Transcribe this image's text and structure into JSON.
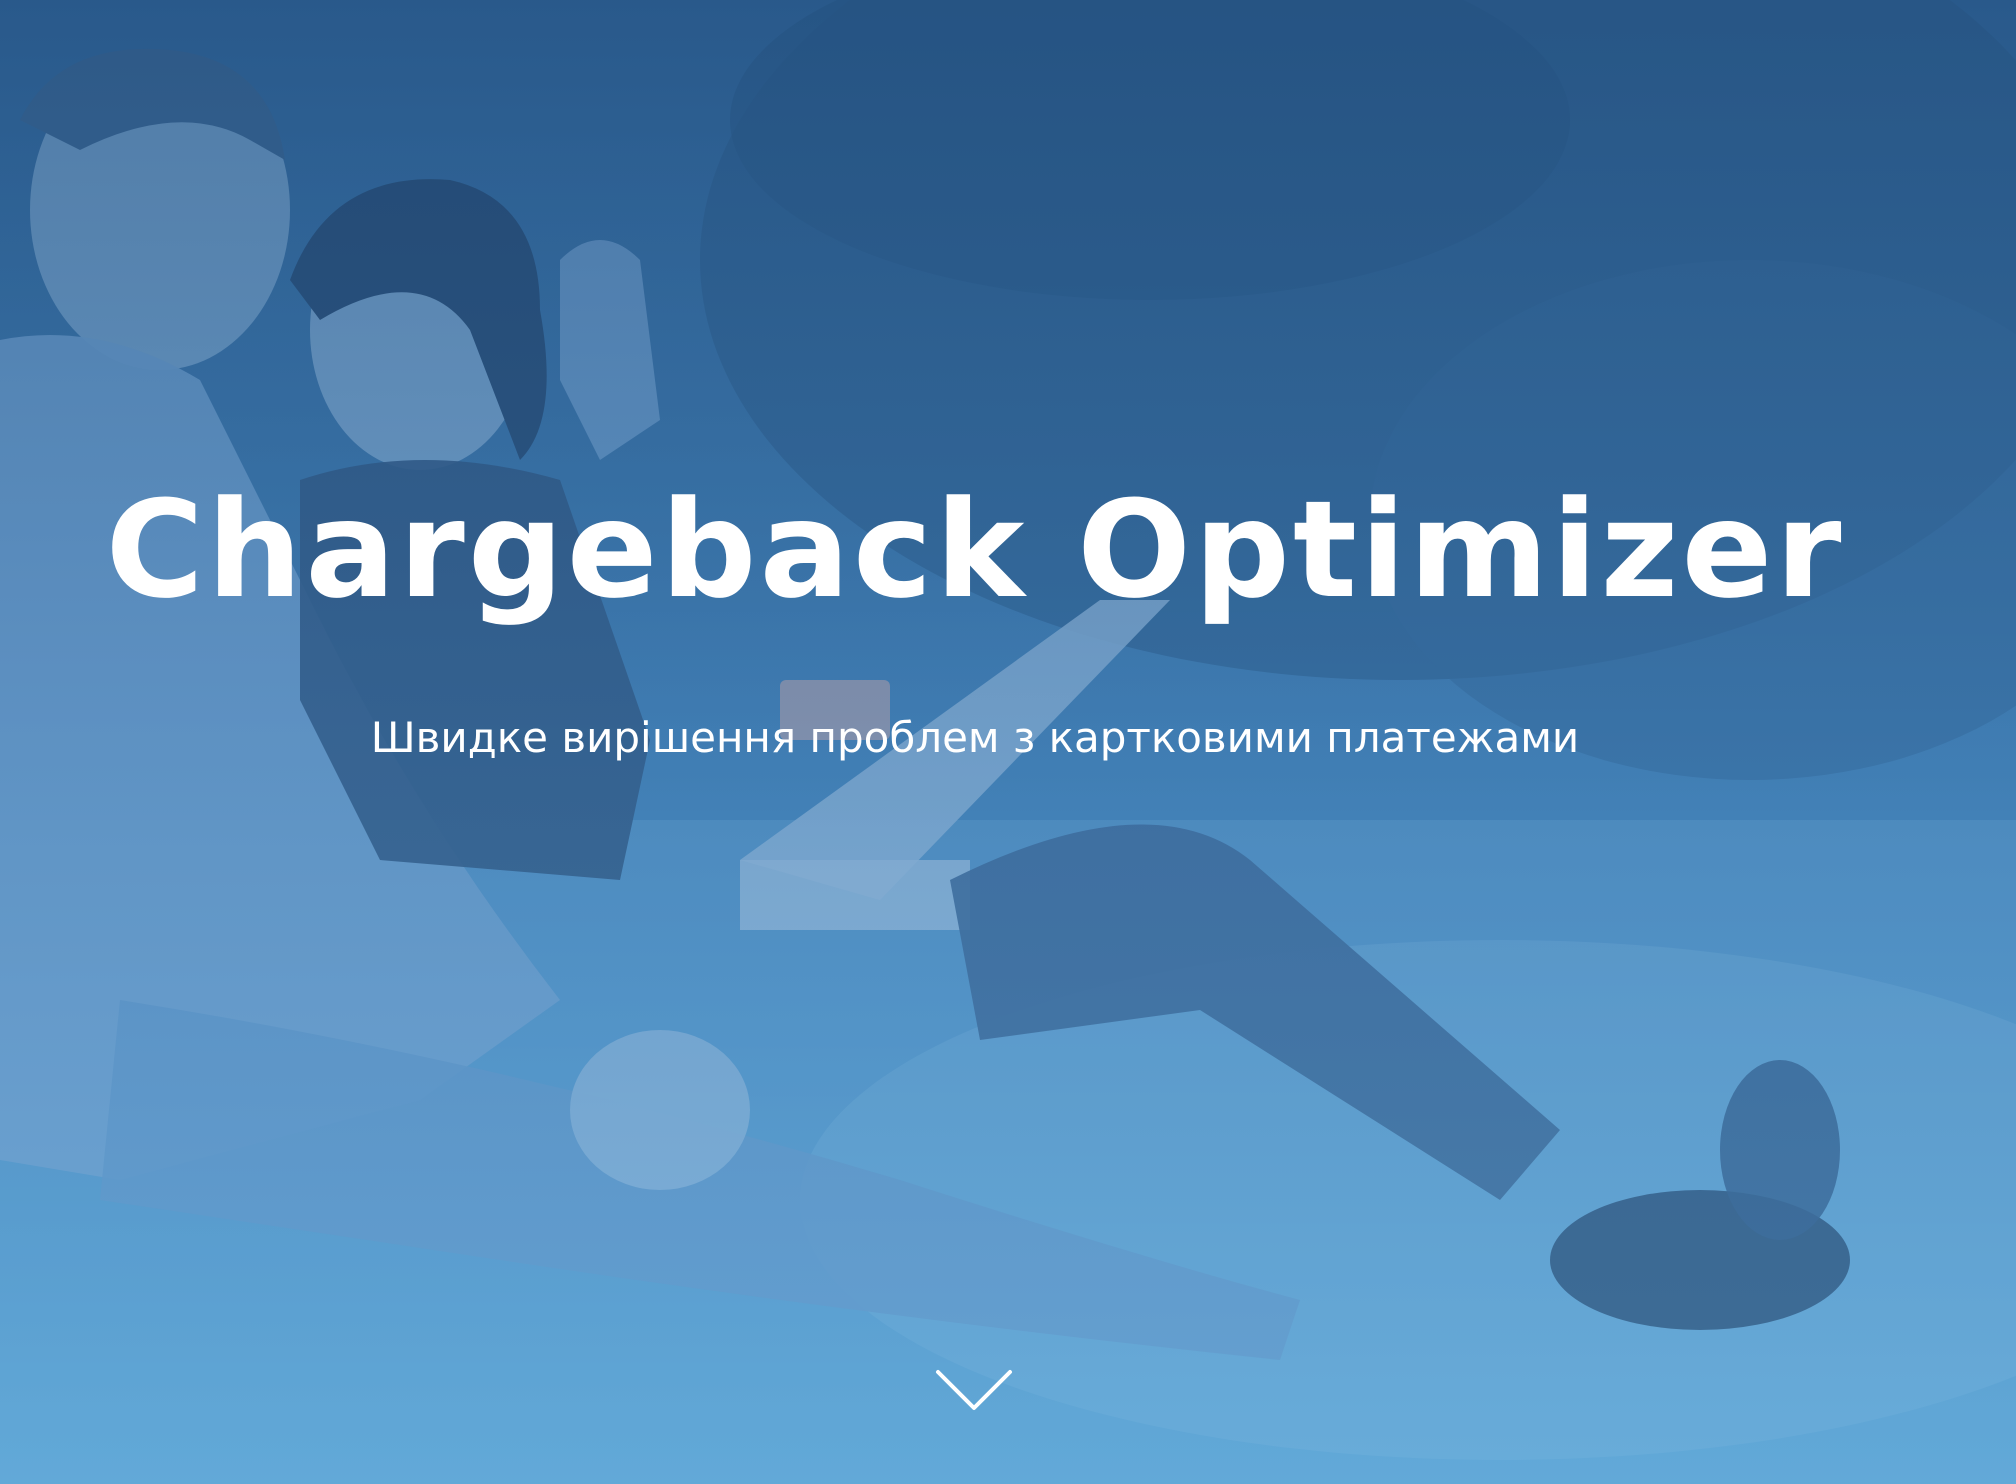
{
  "hero": {
    "title": "Chargeback Optimizer",
    "subtitle": "Швидке вирішення проблем з картковими платежами",
    "scroll_icon": "chevron-down-icon"
  },
  "colors": {
    "overlay_top": "#2f5f8f",
    "overlay_bottom": "#63afdc",
    "text": "#ffffff"
  }
}
